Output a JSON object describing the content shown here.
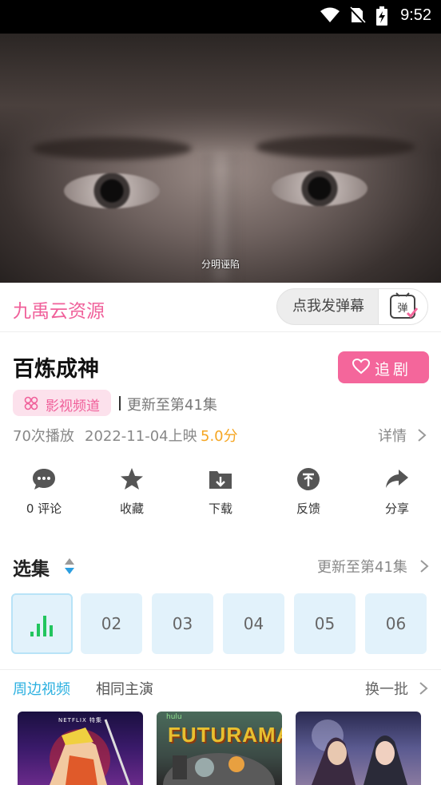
{
  "status_bar": {
    "time": "9:52"
  },
  "video": {
    "subtitle": "分明诬陷"
  },
  "danmu": {
    "source_name": "九禹云资源",
    "send_label": "点我发弹幕",
    "toggle_text": "弹"
  },
  "show": {
    "title": "百炼成神",
    "follow_label": "追剧",
    "channel_tag": "影视频道",
    "update_text": "更新至第41集",
    "plays": "70次播放",
    "date": "2022-11-04上映",
    "score": "5.0分",
    "detail_label": "详情"
  },
  "actions": [
    {
      "label": "0 评论",
      "icon": "comment-icon"
    },
    {
      "label": "收藏",
      "icon": "star-icon"
    },
    {
      "label": "下载",
      "icon": "download-icon"
    },
    {
      "label": "反馈",
      "icon": "feedback-icon"
    },
    {
      "label": "分享",
      "icon": "share-icon"
    }
  ],
  "episodes": {
    "header": "选集",
    "update_text": "更新至第41集",
    "items": [
      "02",
      "03",
      "04",
      "05",
      "06"
    ]
  },
  "related": {
    "tabs": [
      "周边视频",
      "相同主演"
    ],
    "swap_label": "换一批",
    "covers": [
      {
        "caption": "NETFLIX 特集"
      },
      {
        "brand": "hulu",
        "logo": "FUTURAMA"
      },
      {
        "caption": ""
      }
    ]
  },
  "colors": {
    "accent_pink": "#f4669b",
    "accent_blue": "#2bb0e0",
    "score_orange": "#f5a623",
    "playing_green": "#22c55e"
  }
}
